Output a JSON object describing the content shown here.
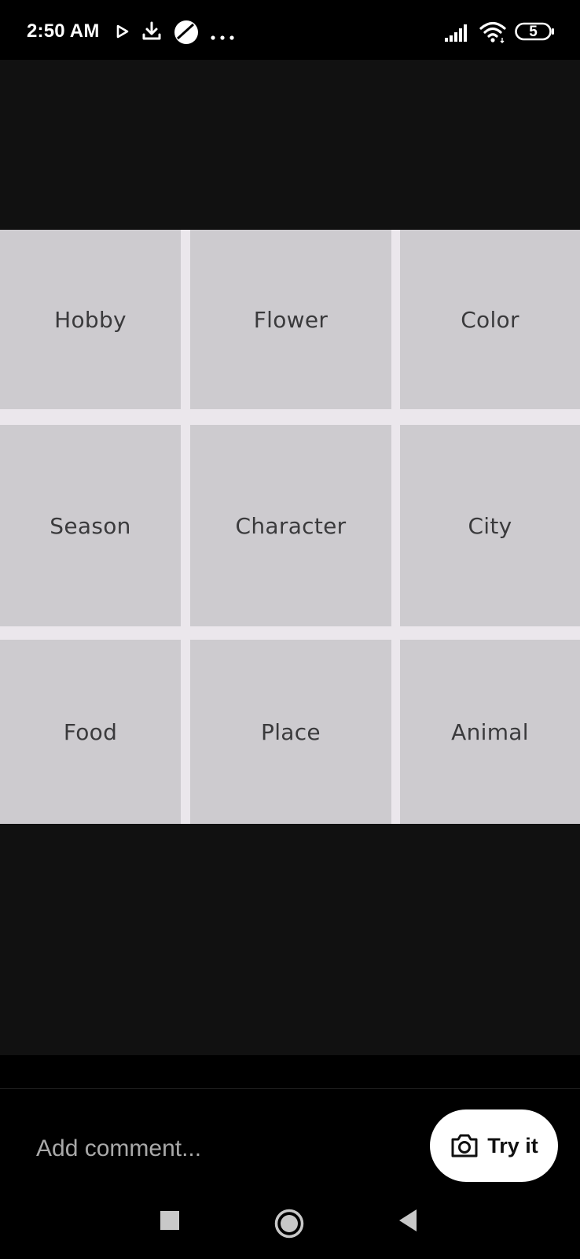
{
  "status_bar": {
    "time": "2:50 AM",
    "battery": "5",
    "icons": [
      "play-icon",
      "download-icon",
      "browser-icon",
      "more-dots-icon",
      "signal-icon",
      "wifi-icon",
      "battery-icon"
    ]
  },
  "grid": {
    "cells": [
      "Hobby",
      "Flower",
      "Color",
      "Season",
      "Character",
      "City",
      "Food",
      "Place",
      "Animal"
    ]
  },
  "comment_bar": {
    "placeholder": "Add comment...",
    "try_label": "Try it",
    "try_icon": "camera-icon"
  },
  "nav_bar": {
    "icons": [
      "recents-square-icon",
      "home-circle-icon",
      "back-triangle-icon"
    ]
  },
  "colors": {
    "background": "#000000",
    "media_bg": "#111111",
    "cell": "#cdcbcf",
    "grid_gap": "#ebe7ec",
    "button": "#ffffff"
  }
}
